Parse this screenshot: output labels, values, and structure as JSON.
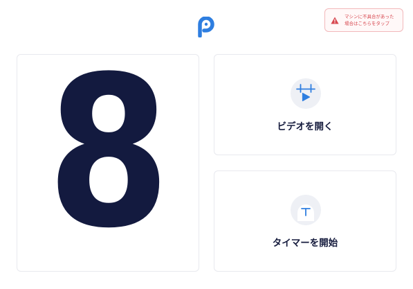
{
  "header": {
    "logo": {
      "icon": "logo-p-icon",
      "color": "#2e7ee0"
    },
    "report_button": {
      "icon": "warning-icon",
      "line1": "マシンに不具合があった",
      "line2": "場合はこちらをタップ",
      "text_color": "#d7474f",
      "border_color": "#f2b8bb"
    }
  },
  "number_panel": {
    "value": "8",
    "color": "#131a3f"
  },
  "actions": {
    "video": {
      "label": "ビデオを開く",
      "icon": "calendar-play-icon"
    },
    "timer": {
      "label": "タイマーを開始",
      "icon": "timer-icon"
    }
  },
  "colors": {
    "accent": "#2e7ee0",
    "text": "#151b3d",
    "card_border": "#e8e9ee",
    "icon_bg": "#eef0f5"
  }
}
